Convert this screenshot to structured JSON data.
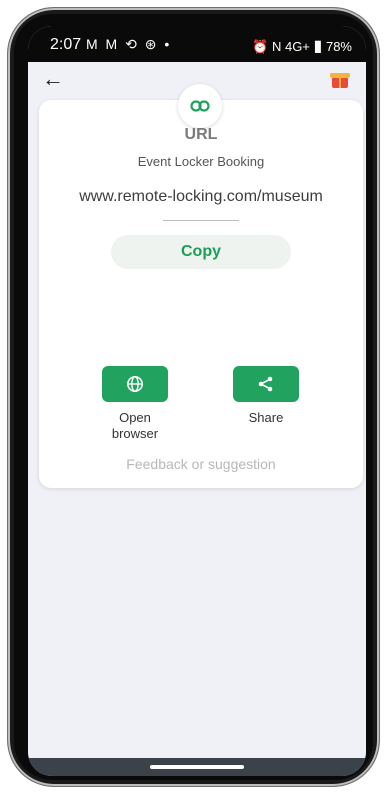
{
  "status_bar": {
    "time": "2:07",
    "notifications": "M M ⟲ ⊛ •",
    "right_icons": "⏰ N 4G+",
    "battery": "78%"
  },
  "topbar": {
    "back_icon": "←"
  },
  "card": {
    "type": "URL",
    "subtitle": "Event Locker Booking",
    "url": "www.remote-locking.com/museum",
    "copy_label": "Copy",
    "actions": {
      "open_label": "Open\nbrowser",
      "share_label": "Share"
    },
    "feedback": "Feedback or suggestion"
  },
  "colors": {
    "accent": "#21a25f",
    "background": "#f0f0f7"
  }
}
